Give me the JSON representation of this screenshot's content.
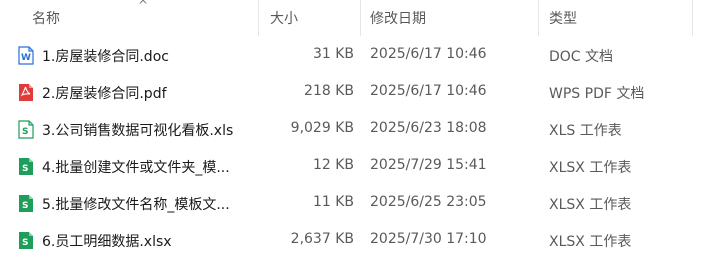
{
  "columns": {
    "name": "名称",
    "size": "大小",
    "modified": "修改日期",
    "type": "类型"
  },
  "files": [
    {
      "name": "1.房屋装修合同.doc",
      "size": "31 KB",
      "modified": "2025/6/17 10:46",
      "type": "DOC 文档",
      "icon": "word-doc-icon",
      "accent": "#2b6fd6"
    },
    {
      "name": "2.房屋装修合同.pdf",
      "size": "218 KB",
      "modified": "2025/6/17 10:46",
      "type": "WPS PDF 文档",
      "icon": "pdf-icon",
      "accent": "#e03b3b"
    },
    {
      "name": "3.公司销售数据可视化看板.xls",
      "size": "9,029 KB",
      "modified": "2025/6/23 18:08",
      "type": "XLS 工作表",
      "icon": "excel-xls-icon",
      "accent": "#1e9e5a"
    },
    {
      "name": "4.批量创建文件或文件夹_模...",
      "size": "12 KB",
      "modified": "2025/7/29 15:41",
      "type": "XLSX 工作表",
      "icon": "excel-xlsx-icon",
      "accent": "#1e9e5a"
    },
    {
      "name": "5.批量修改文件名称_模板文...",
      "size": "11 KB",
      "modified": "2025/6/25 23:05",
      "type": "XLSX 工作表",
      "icon": "excel-xlsx-icon",
      "accent": "#1e9e5a"
    },
    {
      "name": "6.员工明细数据.xlsx",
      "size": "2,637 KB",
      "modified": "2025/7/30 17:10",
      "type": "XLSX 工作表",
      "icon": "excel-xlsx-icon",
      "accent": "#1e9e5a"
    }
  ]
}
